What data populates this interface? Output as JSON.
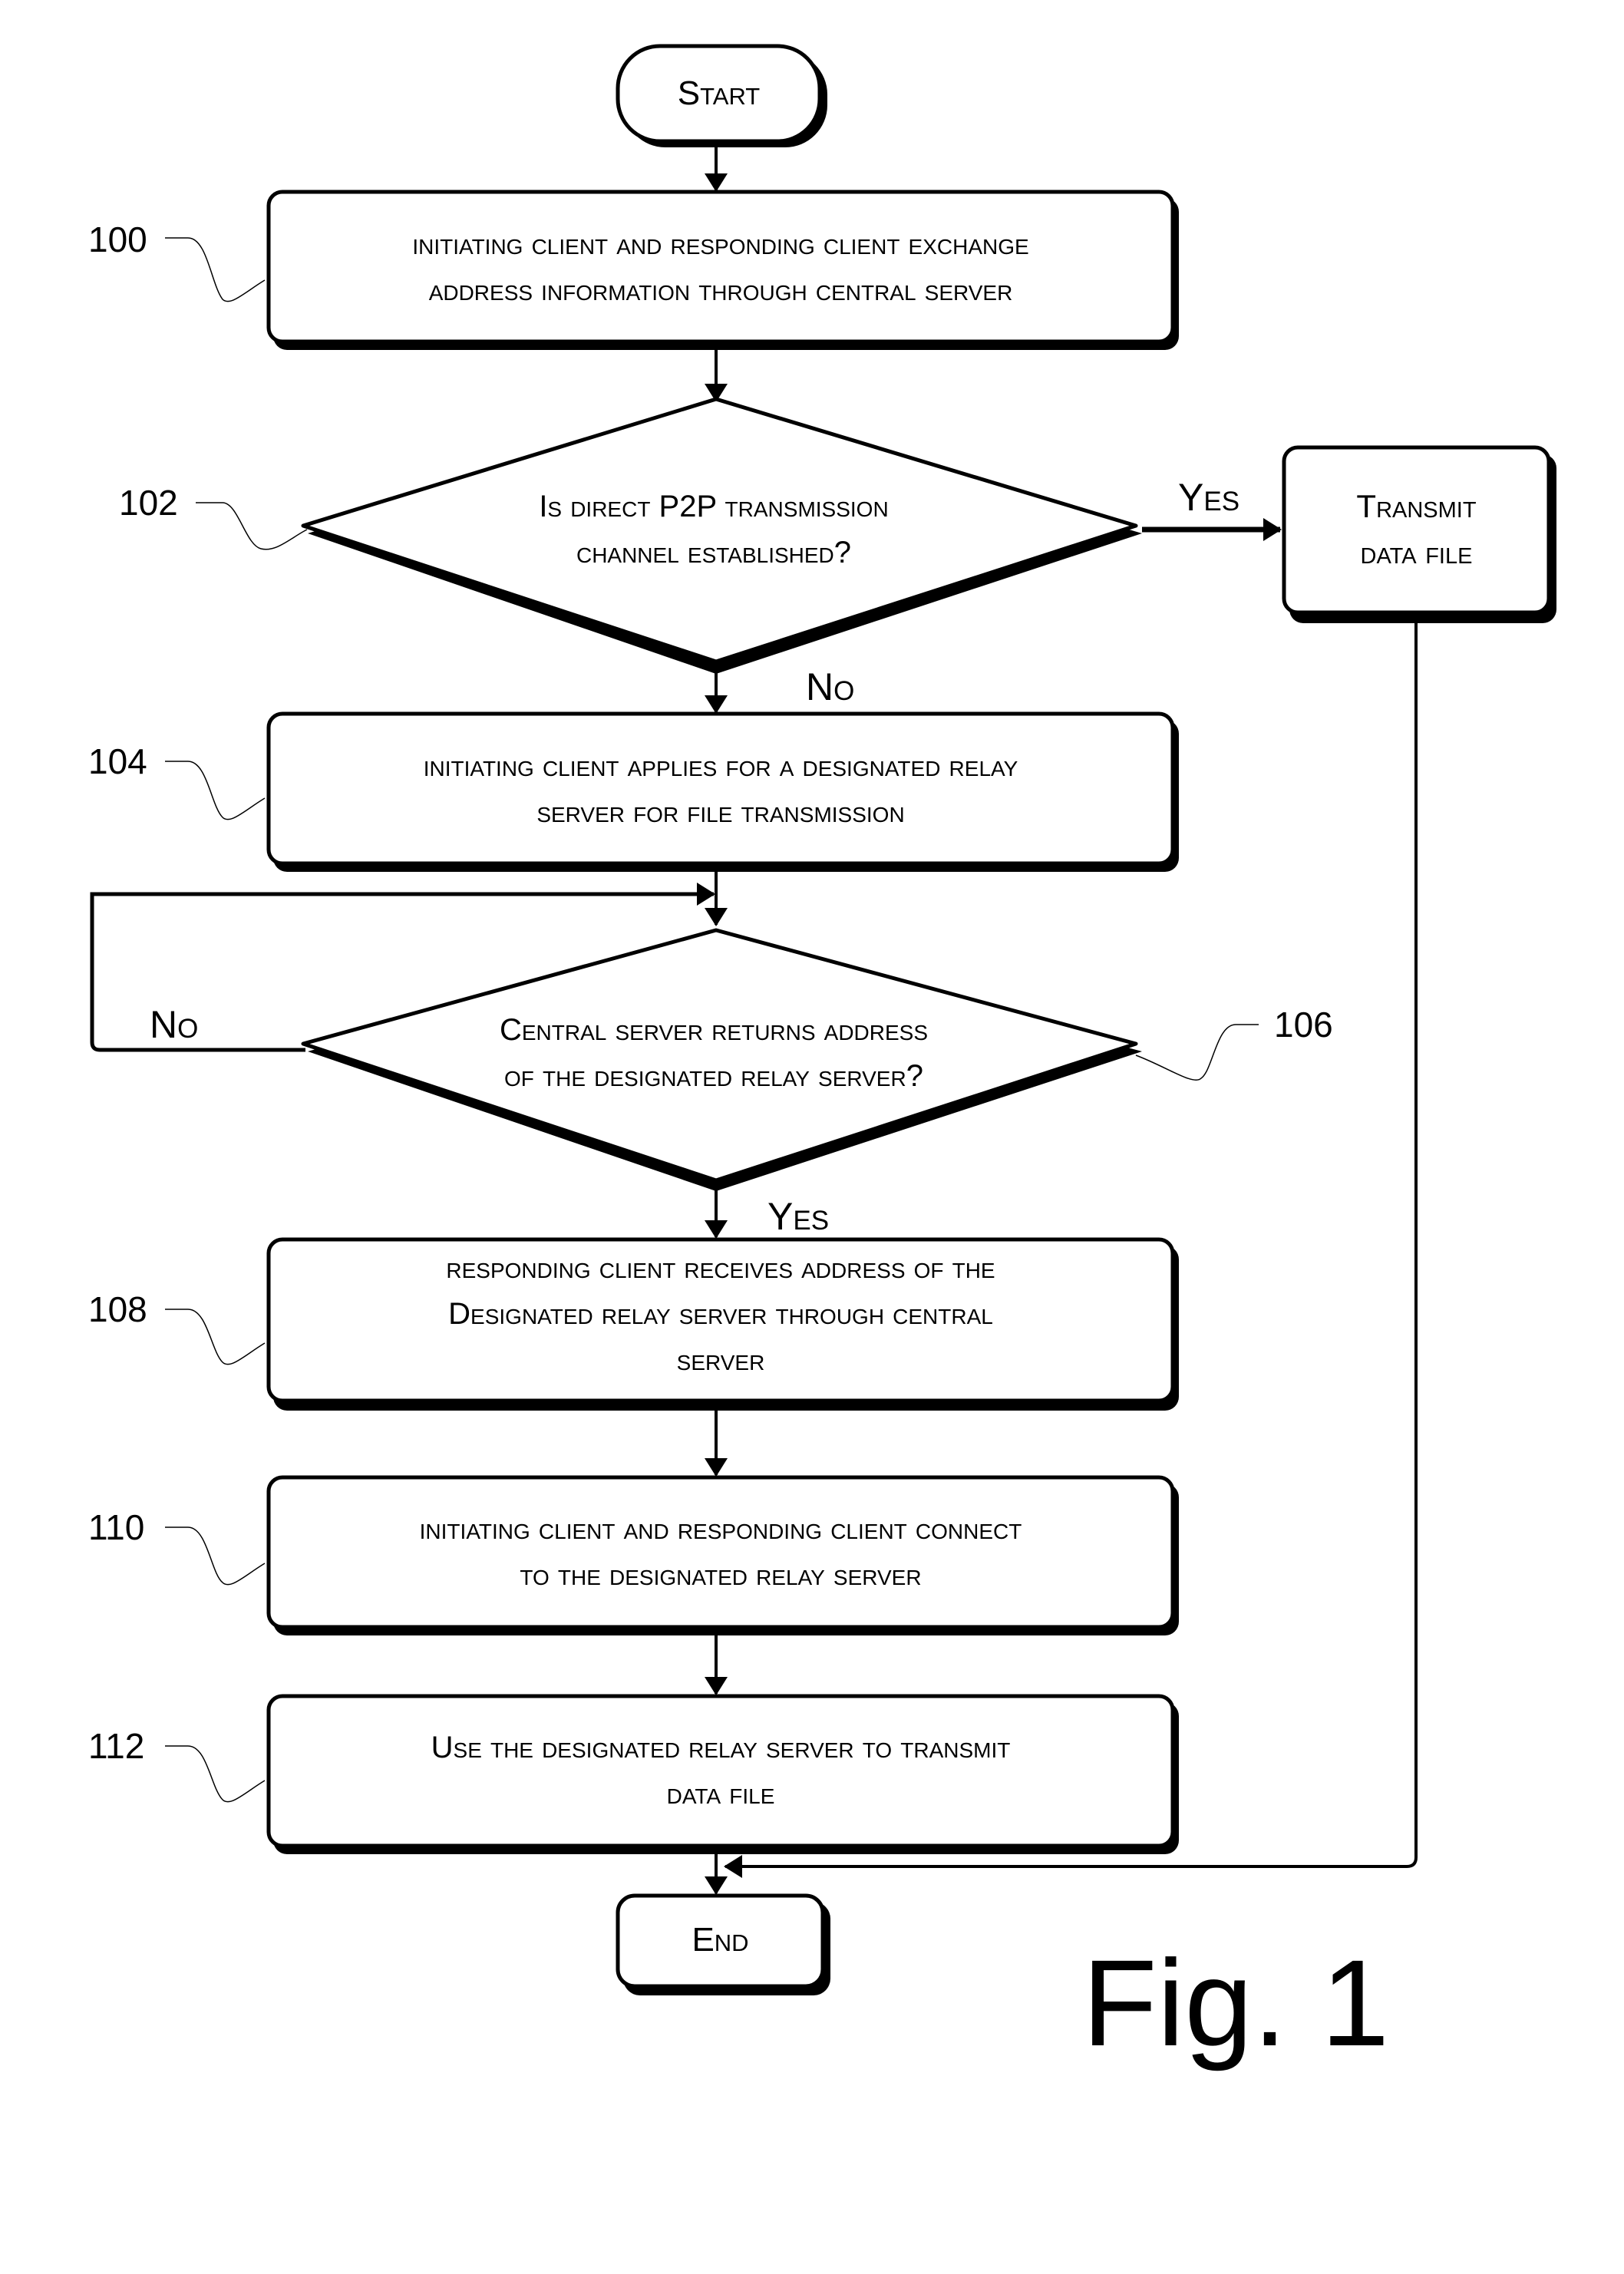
{
  "figure": {
    "title": "Fig. 1"
  },
  "nodes": {
    "start": {
      "label": "Start"
    },
    "step100": {
      "ref": "100",
      "lines": [
        "initiating client and responding client exchange",
        "address information through central server"
      ]
    },
    "step102": {
      "ref": "102",
      "lines": [
        "Is direct P2P transmission",
        "channel established?"
      ]
    },
    "transmit": {
      "lines": [
        "Transmit",
        "data file"
      ]
    },
    "step104": {
      "ref": "104",
      "lines": [
        "initiating client applies for a designated relay",
        "server for file transmission"
      ]
    },
    "step106": {
      "ref": "106",
      "lines": [
        "Central server returns address",
        "of the designated relay server?"
      ]
    },
    "step108": {
      "ref": "108",
      "lines": [
        "responding client receives address of the",
        "Designated relay server through central",
        "server"
      ]
    },
    "step110": {
      "ref": "110",
      "lines": [
        "initiating client and responding client connect",
        "to the designated relay server"
      ]
    },
    "step112": {
      "ref": "112",
      "lines": [
        "Use the designated relay server to transmit",
        "data file"
      ]
    },
    "end": {
      "label": "End"
    }
  },
  "edges": {
    "yes_102": "Yes",
    "no_102": "No",
    "no_106": "No",
    "yes_106": "Yes"
  }
}
